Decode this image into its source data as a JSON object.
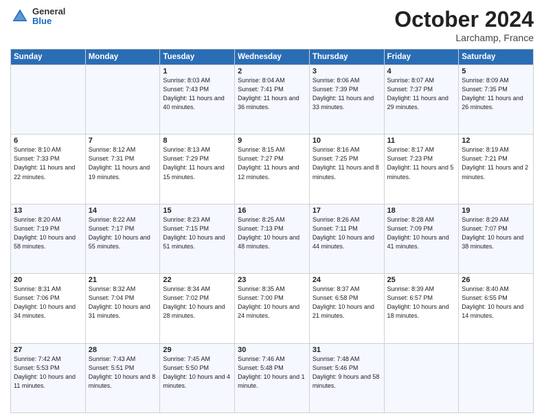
{
  "header": {
    "month_title": "October 2024",
    "location": "Larchamp, France",
    "logo_general": "General",
    "logo_blue": "Blue"
  },
  "days_of_week": [
    "Sunday",
    "Monday",
    "Tuesday",
    "Wednesday",
    "Thursday",
    "Friday",
    "Saturday"
  ],
  "weeks": [
    [
      {
        "day": "",
        "info": ""
      },
      {
        "day": "",
        "info": ""
      },
      {
        "day": "1",
        "info": "Sunrise: 8:03 AM\nSunset: 7:43 PM\nDaylight: 11 hours and 40 minutes."
      },
      {
        "day": "2",
        "info": "Sunrise: 8:04 AM\nSunset: 7:41 PM\nDaylight: 11 hours and 36 minutes."
      },
      {
        "day": "3",
        "info": "Sunrise: 8:06 AM\nSunset: 7:39 PM\nDaylight: 11 hours and 33 minutes."
      },
      {
        "day": "4",
        "info": "Sunrise: 8:07 AM\nSunset: 7:37 PM\nDaylight: 11 hours and 29 minutes."
      },
      {
        "day": "5",
        "info": "Sunrise: 8:09 AM\nSunset: 7:35 PM\nDaylight: 11 hours and 26 minutes."
      }
    ],
    [
      {
        "day": "6",
        "info": "Sunrise: 8:10 AM\nSunset: 7:33 PM\nDaylight: 11 hours and 22 minutes."
      },
      {
        "day": "7",
        "info": "Sunrise: 8:12 AM\nSunset: 7:31 PM\nDaylight: 11 hours and 19 minutes."
      },
      {
        "day": "8",
        "info": "Sunrise: 8:13 AM\nSunset: 7:29 PM\nDaylight: 11 hours and 15 minutes."
      },
      {
        "day": "9",
        "info": "Sunrise: 8:15 AM\nSunset: 7:27 PM\nDaylight: 11 hours and 12 minutes."
      },
      {
        "day": "10",
        "info": "Sunrise: 8:16 AM\nSunset: 7:25 PM\nDaylight: 11 hours and 8 minutes."
      },
      {
        "day": "11",
        "info": "Sunrise: 8:17 AM\nSunset: 7:23 PM\nDaylight: 11 hours and 5 minutes."
      },
      {
        "day": "12",
        "info": "Sunrise: 8:19 AM\nSunset: 7:21 PM\nDaylight: 11 hours and 2 minutes."
      }
    ],
    [
      {
        "day": "13",
        "info": "Sunrise: 8:20 AM\nSunset: 7:19 PM\nDaylight: 10 hours and 58 minutes."
      },
      {
        "day": "14",
        "info": "Sunrise: 8:22 AM\nSunset: 7:17 PM\nDaylight: 10 hours and 55 minutes."
      },
      {
        "day": "15",
        "info": "Sunrise: 8:23 AM\nSunset: 7:15 PM\nDaylight: 10 hours and 51 minutes."
      },
      {
        "day": "16",
        "info": "Sunrise: 8:25 AM\nSunset: 7:13 PM\nDaylight: 10 hours and 48 minutes."
      },
      {
        "day": "17",
        "info": "Sunrise: 8:26 AM\nSunset: 7:11 PM\nDaylight: 10 hours and 44 minutes."
      },
      {
        "day": "18",
        "info": "Sunrise: 8:28 AM\nSunset: 7:09 PM\nDaylight: 10 hours and 41 minutes."
      },
      {
        "day": "19",
        "info": "Sunrise: 8:29 AM\nSunset: 7:07 PM\nDaylight: 10 hours and 38 minutes."
      }
    ],
    [
      {
        "day": "20",
        "info": "Sunrise: 8:31 AM\nSunset: 7:06 PM\nDaylight: 10 hours and 34 minutes."
      },
      {
        "day": "21",
        "info": "Sunrise: 8:32 AM\nSunset: 7:04 PM\nDaylight: 10 hours and 31 minutes."
      },
      {
        "day": "22",
        "info": "Sunrise: 8:34 AM\nSunset: 7:02 PM\nDaylight: 10 hours and 28 minutes."
      },
      {
        "day": "23",
        "info": "Sunrise: 8:35 AM\nSunset: 7:00 PM\nDaylight: 10 hours and 24 minutes."
      },
      {
        "day": "24",
        "info": "Sunrise: 8:37 AM\nSunset: 6:58 PM\nDaylight: 10 hours and 21 minutes."
      },
      {
        "day": "25",
        "info": "Sunrise: 8:39 AM\nSunset: 6:57 PM\nDaylight: 10 hours and 18 minutes."
      },
      {
        "day": "26",
        "info": "Sunrise: 8:40 AM\nSunset: 6:55 PM\nDaylight: 10 hours and 14 minutes."
      }
    ],
    [
      {
        "day": "27",
        "info": "Sunrise: 7:42 AM\nSunset: 5:53 PM\nDaylight: 10 hours and 11 minutes."
      },
      {
        "day": "28",
        "info": "Sunrise: 7:43 AM\nSunset: 5:51 PM\nDaylight: 10 hours and 8 minutes."
      },
      {
        "day": "29",
        "info": "Sunrise: 7:45 AM\nSunset: 5:50 PM\nDaylight: 10 hours and 4 minutes."
      },
      {
        "day": "30",
        "info": "Sunrise: 7:46 AM\nSunset: 5:48 PM\nDaylight: 10 hours and 1 minute."
      },
      {
        "day": "31",
        "info": "Sunrise: 7:48 AM\nSunset: 5:46 PM\nDaylight: 9 hours and 58 minutes."
      },
      {
        "day": "",
        "info": ""
      },
      {
        "day": "",
        "info": ""
      }
    ]
  ]
}
